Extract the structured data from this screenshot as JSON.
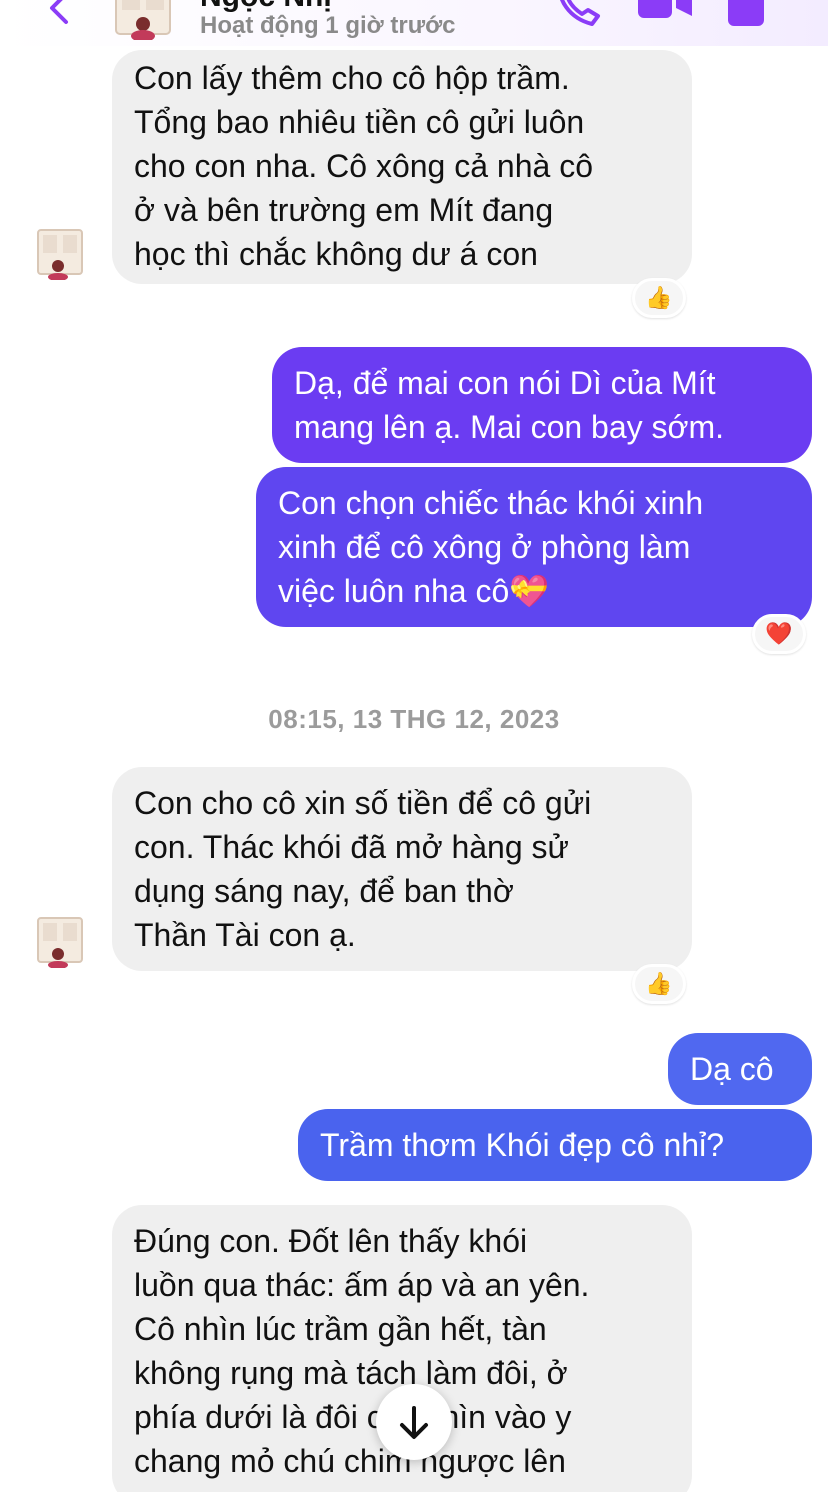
{
  "header": {
    "name": "Ngọc Nhị",
    "status": "Hoạt động 1 giờ trước"
  },
  "messages": [
    {
      "direction": "in",
      "text": "Con lấy thêm cho cô hộp trầm.\nTổng bao nhiêu tiền cô gửi luôn\ncho con nha. Cô xông cả nhà cô\nở và bên trường em Mít đang\nhọc thì chắc không dư á con",
      "reaction": "👍"
    },
    {
      "direction": "out",
      "text": "Dạ, để mai con nói Dì của Mít\nmang lên ạ. Mai con bay sớm."
    },
    {
      "direction": "out",
      "text": "Con chọn chiếc thác khói xinh\nxinh để cô xông ở phòng làm\nviệc luôn nha cô💝",
      "reaction": "❤️"
    },
    {
      "direction": "in",
      "text": "Con cho cô xin số tiền để cô gửi\ncon. Thác khói đã mở hàng sử\ndụng sáng nay, để ban thờ\nThần Tài con ạ.",
      "reaction": "👍"
    },
    {
      "direction": "out",
      "text": "Dạ cô"
    },
    {
      "direction": "out",
      "text": "Trầm thơm Khói đẹp cô nhỉ?"
    },
    {
      "direction": "in",
      "text": "Đúng con. Đốt lên thấy khói\nluồn qua thác: ấm áp và an yên.\nCô nhìn lúc trầm gần hết, tàn\nkhông rụng mà tách làm đôi, ở\nphía dưới là đôi cổ. Nhìn vào y\nchang mỏ chú chim ngược lên"
    }
  ],
  "timestamp": "08:15, 13 THG 12, 2023",
  "colors": {
    "incoming_bubble": "#efefef",
    "outgoing_purple": "#6b3cf2",
    "outgoing_blue": "#4a63ee",
    "accent": "#8b3cf7",
    "timestamp": "#9b9b9b"
  },
  "icons": {
    "back": "chevron-left-icon",
    "call": "phone-icon",
    "video": "video-camera-icon",
    "info": "info-icon",
    "scroll": "arrow-down-icon"
  }
}
